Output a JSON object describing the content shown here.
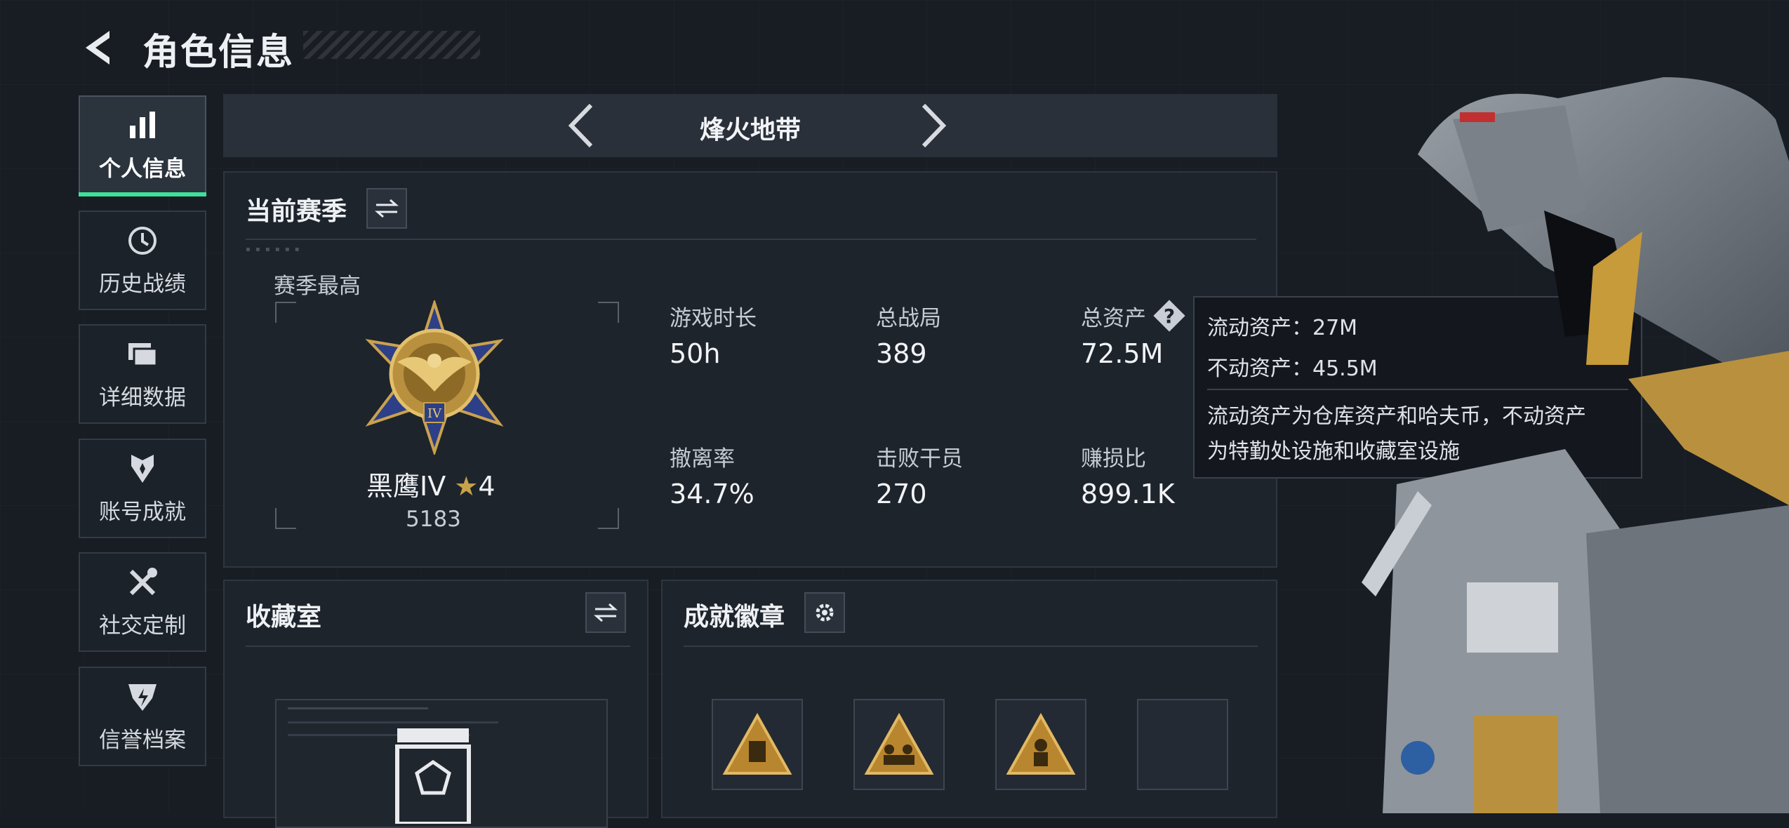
{
  "header": {
    "title": "角色信息"
  },
  "sidebar": {
    "items": [
      {
        "label": "个人信息",
        "active": true,
        "icon": "bar-chart-icon"
      },
      {
        "label": "历史战绩",
        "active": false,
        "icon": "history-clock-icon"
      },
      {
        "label": "详细数据",
        "active": false,
        "icon": "folders-icon"
      },
      {
        "label": "账号成就",
        "active": false,
        "icon": "achievement-icon"
      },
      {
        "label": "社交定制",
        "active": false,
        "icon": "tools-icon"
      },
      {
        "label": "信誉档案",
        "active": false,
        "icon": "reputation-shield-icon"
      }
    ]
  },
  "mode_selector": {
    "current": "烽火地带"
  },
  "season": {
    "title": "当前赛季",
    "best_label": "赛季最高",
    "rank_name": "黑鹰IV",
    "rank_stars": "4",
    "rank_score": "5183",
    "stats": [
      {
        "label": "游戏时长",
        "value": "50h"
      },
      {
        "label": "总战局",
        "value": "389"
      },
      {
        "label": "总资产",
        "value": "72.5M"
      },
      {
        "label": "撤离率",
        "value": "34.7%"
      },
      {
        "label": "击败干员",
        "value": "270"
      },
      {
        "label": "赚损比",
        "value": "899.1K"
      }
    ]
  },
  "tooltip": {
    "liquid": "流动资产：27M",
    "fixed": "不动资产：45.5M",
    "desc_line1": "流动资产为仓库资产和哈夫币，不动资产",
    "desc_line2": "为特勤处设施和收藏室设施"
  },
  "collection": {
    "title": "收藏室"
  },
  "badges": {
    "title": "成就徽章"
  },
  "colors": {
    "accent_green": "#3fe09a",
    "gold": "#c79a3a",
    "panel": "#1e242c",
    "background": "#181d24"
  }
}
